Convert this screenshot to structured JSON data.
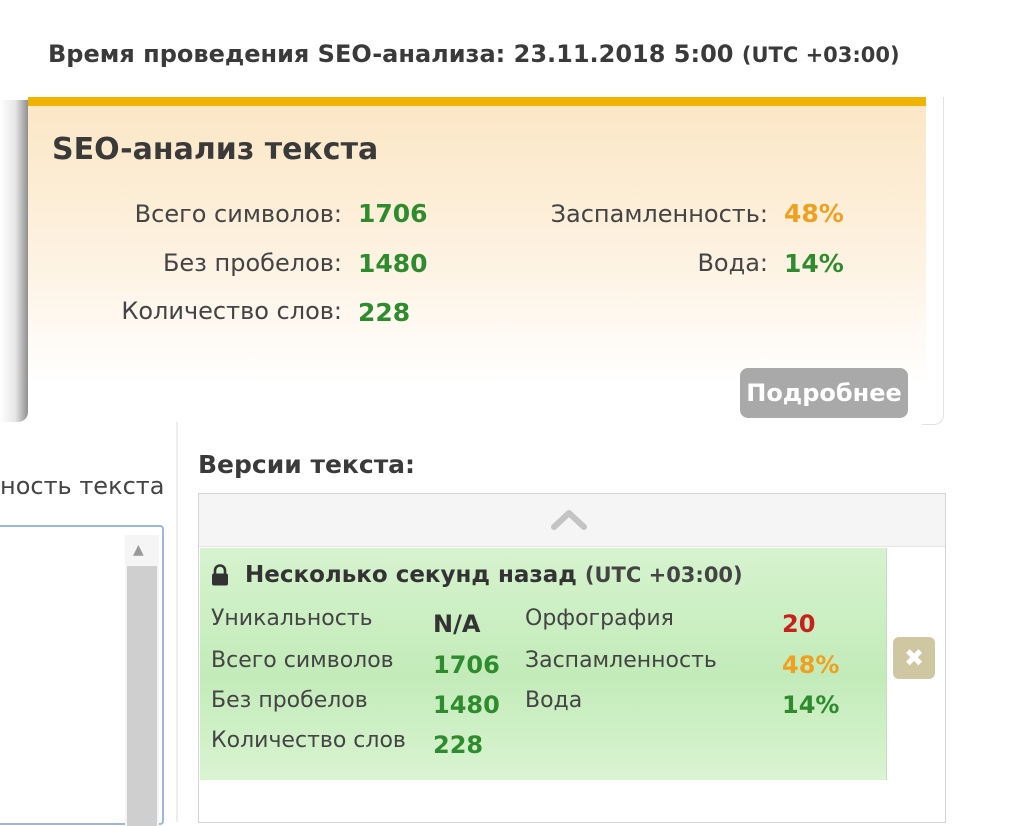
{
  "header": {
    "analysis_time_label": "Время проведения SEO-анализа:",
    "analysis_time_value": "23.11.2018 5:00",
    "analysis_time_tz": "(UTC +03:00)"
  },
  "seo": {
    "title": "SEO-анализ текста",
    "stats": {
      "total_chars_label": "Всего символов:",
      "total_chars": "1706",
      "no_spaces_label": "Без пробелов:",
      "no_spaces": "1480",
      "words_label": "Количество слов:",
      "words": "228",
      "spam_label": "Заспамленность:",
      "spam": "48%",
      "water_label": "Вода:",
      "water": "14%"
    },
    "more_button": "Подробнее"
  },
  "left_panel": {
    "tab_label": "ность текста"
  },
  "versions": {
    "title": "Версии текста:",
    "items": [
      {
        "title": "Несколько секунд назад",
        "tz": "(UTC +03:00)",
        "uniqueness_label": "Уникальность",
        "uniqueness": "N/A",
        "total_chars_label": "Всего символов",
        "total_chars": "1706",
        "no_spaces_label": "Без пробелов",
        "no_spaces": "1480",
        "words_label": "Количество слов",
        "words": "228",
        "spelling_label": "Орфография",
        "spelling": "20",
        "spam_label": "Заспамленность",
        "spam": "48%",
        "water_label": "Вода",
        "water": "14%",
        "delete_symbol": "✖"
      }
    ]
  },
  "icons": {
    "lock": "lock-icon",
    "collapse": "chevron-up-icon",
    "scroll_up": "arrow-up-icon",
    "delete": "close-icon"
  },
  "colors": {
    "accent_orange": "#f0b400",
    "good_green": "#2e8b2e",
    "warn_orange": "#f0a020",
    "bad_red": "#c8201a",
    "version_bg": "#c3ebb9"
  }
}
